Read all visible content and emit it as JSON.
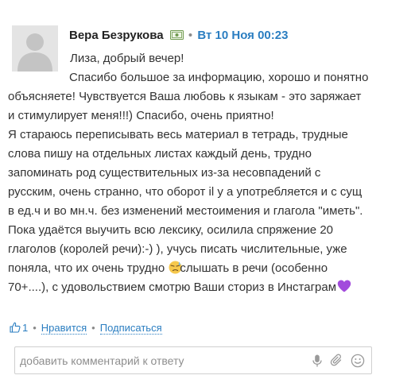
{
  "comment": {
    "author": "Вера Безрукова",
    "badge_icon": "certificate-badge-icon",
    "separator": "•",
    "datetime": "Вт 10 Ноя 00:23",
    "lines": [
      "Лиза, добрый вечер!",
      "Спасибо большое за информацию, хорошо и понятно",
      "объясняете! Чувствуется Ваша любовь к языкам - это заряжает",
      "и стимулирует меня!!!) Спасибо, очень приятно!",
      "Я стараюсь переписывать весь материал в тетрадь, трудные",
      "слова пишу на отдельных листах каждый день, трудно",
      "запоминать род существительных из-за несовпадений с",
      "русским, очень странно, что оборот il y a употребляется и с сущ",
      "в ед.ч и во мн.ч. без изменений местоимения и глагола \"иметь\".",
      "Пока удаётся выучить всю лексику, осилила спряжение 20",
      "глаголов (королей речи):-) ), учусь писать числительные, уже",
      "поняла, что их очень трудно",
      "слышать в речи (особенно",
      "70+....), с удовольствием смотрю Ваши сториз в Инстаграм"
    ],
    "emoji": {
      "sweat": "downcast-sweat-emoji-icon",
      "heart": "purple-heart-emoji-icon"
    }
  },
  "actions": {
    "like_icon": "thumbs-up-icon",
    "like_count": "1",
    "like_label": "Нравится",
    "subscribe_label": "Подписаться",
    "separator": "•"
  },
  "reply": {
    "placeholder": "добавить комментарий к ответу",
    "icons": [
      "microphone-icon",
      "paperclip-icon",
      "smiley-icon"
    ]
  },
  "colors": {
    "link": "#2b7ec1",
    "text": "#333333",
    "heart": "#a24bdc"
  }
}
